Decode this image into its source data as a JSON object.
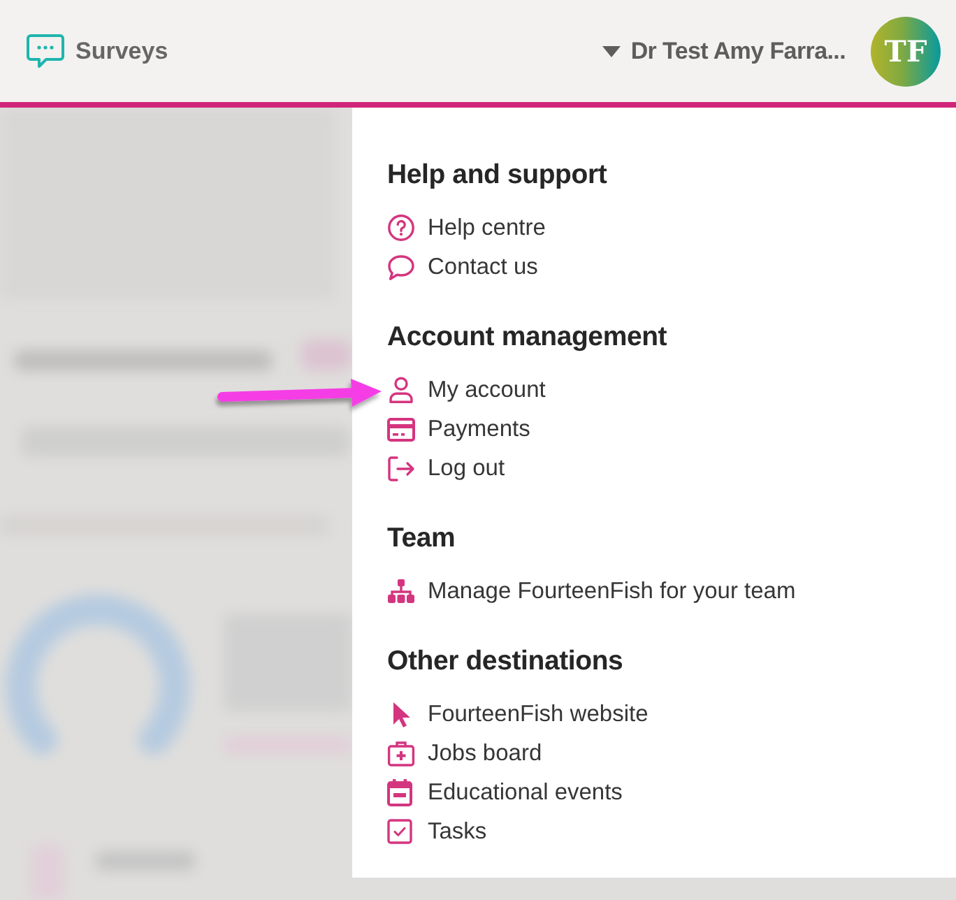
{
  "header": {
    "app": {
      "label": "Surveys"
    },
    "user_menu": {
      "name": "Dr Test Amy Farra...",
      "expanded": true
    },
    "avatar": {
      "initials": "TF"
    }
  },
  "menu": {
    "sections": [
      {
        "heading": "Help and support",
        "items": [
          {
            "label": "Help centre"
          },
          {
            "label": "Contact us"
          }
        ]
      },
      {
        "heading": "Account management",
        "items": [
          {
            "label": "My account"
          },
          {
            "label": "Payments"
          },
          {
            "label": "Log out"
          }
        ]
      },
      {
        "heading": "Team",
        "items": [
          {
            "label": "Manage FourteenFish for your team"
          }
        ]
      },
      {
        "heading": "Other destinations",
        "items": [
          {
            "label": "FourteenFish website"
          },
          {
            "label": "Jobs board"
          },
          {
            "label": "Educational events"
          },
          {
            "label": "Tasks"
          }
        ]
      }
    ]
  }
}
